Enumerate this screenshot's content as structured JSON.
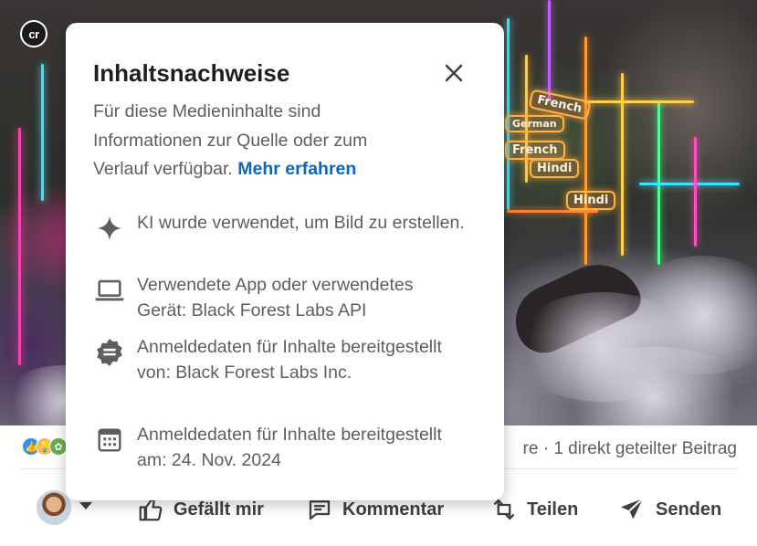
{
  "image": {
    "badge": "cr",
    "tags": [
      "French",
      "Hindi",
      "French",
      "Hindi",
      "German"
    ]
  },
  "modal": {
    "title": "Inhaltsnachweise",
    "description": "Für diese Medieninhalte sind Informationen zur Quelle oder zum Verlauf verfügbar.",
    "learn_more": "Mehr erfahren",
    "items": [
      {
        "icon": "sparkle-icon",
        "text": "KI wurde verwendet, um Bild zu erstellen."
      },
      {
        "icon": "laptop-icon",
        "text": "Verwendete App oder verwendetes Gerät: Black Forest Labs API"
      },
      {
        "icon": "verified-badge-icon",
        "text": "Anmeldedaten für Inhalte bereitgestellt von: Black Forest Labs Inc."
      },
      {
        "icon": "calendar-icon",
        "text": "Anmeldedaten für Inhalte bereitgestellt am: 24. Nov. 2024"
      }
    ]
  },
  "social": {
    "shares_text": "re · 1 direkt geteilter Beitrag"
  },
  "actions": {
    "like": "Gefällt mir",
    "comment": "Kommentar",
    "share": "Teilen",
    "send": "Senden"
  },
  "colors": {
    "accent_link": "#0a66c2",
    "text_primary": "#1f1f1f",
    "text_secondary": "#5e5e5e",
    "action_text": "#404040"
  }
}
